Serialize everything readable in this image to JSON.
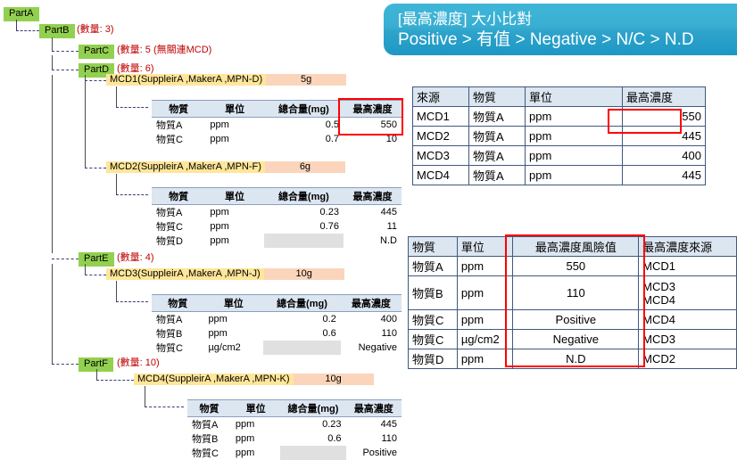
{
  "banner": {
    "line1": "[最高濃度] 大小比對",
    "line2": "Positive > 有值 > Negative > N/C > N.D",
    "bg_color": "#35abd0",
    "text_color": "#ffffff"
  },
  "tree": {
    "chip_color": "#92d050",
    "qty_color": "#c00000",
    "mcd_name_color": "#ffe699",
    "mcd_weight_color": "#fbd5bb",
    "nodes": [
      {
        "name": "PartA",
        "qty": ""
      },
      {
        "name": "PartB",
        "qty": "(數量: 3)"
      },
      {
        "name": "PartC",
        "qty": "(數量: 5 (無關連MCD)"
      },
      {
        "name": "PartD",
        "qty": "(數量: 6)"
      },
      {
        "name": "PartE",
        "qty": "(數量: 4)"
      },
      {
        "name": "PartF",
        "qty": "(數量: 10)"
      }
    ],
    "mcds": [
      {
        "label": "MCD1(SuppleirA ,MakerA ,MPN-D)",
        "weight": "5g"
      },
      {
        "label": "MCD2(SuppleirA ,MakerA ,MPN-F)",
        "weight": "6g"
      },
      {
        "label": "MCD3(SuppleirA ,MakerA ,MPN-J)",
        "weight": "10g"
      },
      {
        "label": "MCD4(SuppleirA ,MakerA ,MPN-K)",
        "weight": "10g"
      }
    ]
  },
  "detail_tables": {
    "headers": [
      "物質",
      "單位",
      "總合量(mg)",
      "最高濃度"
    ],
    "mcd1_rows": [
      {
        "substance": "物質A",
        "unit": "ppm",
        "total": "0.5",
        "conc": "550",
        "blank": false
      },
      {
        "substance": "物質C",
        "unit": "ppm",
        "total": "0.7",
        "conc": "10",
        "blank": false
      }
    ],
    "mcd2_rows": [
      {
        "substance": "物質A",
        "unit": "ppm",
        "total": "0.23",
        "conc": "445",
        "blank": false
      },
      {
        "substance": "物質C",
        "unit": "ppm",
        "total": "0.76",
        "conc": "11",
        "blank": false
      },
      {
        "substance": "物質D",
        "unit": "ppm",
        "total": "",
        "conc": "N.D",
        "blank": true
      }
    ],
    "mcd3_rows": [
      {
        "substance": "物質A",
        "unit": "ppm",
        "total": "0.2",
        "conc": "400",
        "blank": false
      },
      {
        "substance": "物質B",
        "unit": "ppm",
        "total": "0.6",
        "conc": "110",
        "blank": false
      },
      {
        "substance": "物質C",
        "unit": "µg/cm2",
        "total": "",
        "conc": "Negative",
        "blank": true
      }
    ],
    "mcd4_rows": [
      {
        "substance": "物質A",
        "unit": "ppm",
        "total": "0.23",
        "conc": "445",
        "blank": false
      },
      {
        "substance": "物質B",
        "unit": "ppm",
        "total": "0.6",
        "conc": "110",
        "blank": false
      },
      {
        "substance": "物質C",
        "unit": "ppm",
        "total": "",
        "conc": "Positive",
        "blank": true
      }
    ]
  },
  "source_table": {
    "headers": [
      "來源",
      "物質",
      "單位",
      "最高濃度"
    ],
    "rows": [
      {
        "source": "MCD1",
        "substance": "物質A",
        "unit": "ppm",
        "conc": "550"
      },
      {
        "source": "MCD2",
        "substance": "物質A",
        "unit": "ppm",
        "conc": "445"
      },
      {
        "source": "MCD3",
        "substance": "物質A",
        "unit": "ppm",
        "conc": "400"
      },
      {
        "source": "MCD4",
        "substance": "物質A",
        "unit": "ppm",
        "conc": "445"
      }
    ]
  },
  "risk_table": {
    "headers": [
      "物質",
      "單位",
      "最高濃度風險值",
      "最高濃度來源"
    ],
    "rows": [
      {
        "substance": "物質A",
        "unit": "ppm",
        "risk": "550",
        "source": "MCD1"
      },
      {
        "substance": "物質B",
        "unit": "ppm",
        "risk": "110",
        "source": "MCD3\nMCD4"
      },
      {
        "substance": "物質C",
        "unit": "ppm",
        "risk": "Positive",
        "source": "MCD4"
      },
      {
        "substance": "物質C",
        "unit": "µg/cm2",
        "risk": "Negative",
        "source": "MCD3"
      },
      {
        "substance": "物質D",
        "unit": "ppm",
        "risk": "N.D",
        "source": "MCD2"
      }
    ]
  },
  "highlight_color": "#ff0000"
}
